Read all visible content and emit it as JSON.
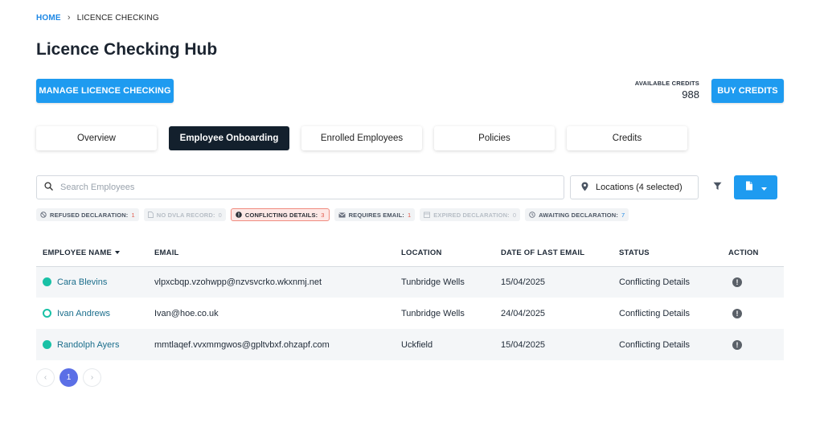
{
  "breadcrumb": {
    "home": "HOME",
    "separator": "›",
    "current": "LICENCE CHECKING"
  },
  "page_title": "Licence Checking Hub",
  "manage_button_label": "MANAGE LICENCE CHECKING",
  "credits": {
    "label": "AVAILABLE CREDITS",
    "value": "988",
    "buy_label": "BUY CREDITS"
  },
  "tabs": [
    {
      "label": "Overview",
      "active": false
    },
    {
      "label": "Employee Onboarding",
      "active": true
    },
    {
      "label": "Enrolled Employees",
      "active": false
    },
    {
      "label": "Policies",
      "active": false
    },
    {
      "label": "Credits",
      "active": false
    }
  ],
  "search": {
    "placeholder": "Search Employees",
    "value": ""
  },
  "locations": {
    "label": "Locations (4 selected)"
  },
  "icons": {
    "search": "search-icon",
    "location": "map-pin-icon",
    "filter": "filter-icon",
    "export": "file-icon",
    "dropdown": "caret-down-icon",
    "action": "exclamation-circle-icon"
  },
  "filters": [
    {
      "label": "REFUSED DECLARATION:",
      "count": "1",
      "state": "normal",
      "count_color": "red"
    },
    {
      "label": "NO DVLA RECORD:",
      "count": "0",
      "state": "disabled",
      "count_color": "grey"
    },
    {
      "label": "CONFLICTING DETAILS:",
      "count": "3",
      "state": "active",
      "count_color": "red"
    },
    {
      "label": "REQUIRES EMAIL:",
      "count": "1",
      "state": "normal",
      "count_color": "red"
    },
    {
      "label": "EXPIRED DECLARATION:",
      "count": "0",
      "state": "disabled",
      "count_color": "grey"
    },
    {
      "label": "AWAITING DECLARATION:",
      "count": "7",
      "state": "normal",
      "count_color": "blue"
    }
  ],
  "table": {
    "headers": [
      "EMPLOYEE NAME",
      "EMAIL",
      "LOCATION",
      "DATE OF LAST EMAIL",
      "STATUS",
      "ACTION"
    ],
    "rows": [
      {
        "name": "Cara Blevins",
        "email": "vlpxcbqp.vzohwpp@nzvsvcrko.wkxnmj.net",
        "location": "Tunbridge Wells",
        "date": "15/04/2025",
        "status": "Conflicting Details",
        "indicator": "filled",
        "action": "!"
      },
      {
        "name": "Ivan Andrews",
        "email": "Ivan@hoe.co.uk",
        "location": "Tunbridge Wells",
        "date": "24/04/2025",
        "status": "Conflicting Details",
        "indicator": "hollow",
        "action": "!"
      },
      {
        "name": "Randolph Ayers",
        "email": "mmtlaqef.vvxmmgwos@gpltvbxf.ohzapf.com",
        "location": "Uckfield",
        "date": "15/04/2025",
        "status": "Conflicting Details",
        "indicator": "filled",
        "action": "!"
      }
    ]
  },
  "pagination": {
    "prev": "‹",
    "current": "1",
    "next": "›"
  },
  "colors": {
    "primary": "#1e9bf0",
    "active_tab": "#13202d",
    "indicator": "#19c1a6",
    "page_current": "#5b6fe6",
    "alert": "#e1584b"
  }
}
